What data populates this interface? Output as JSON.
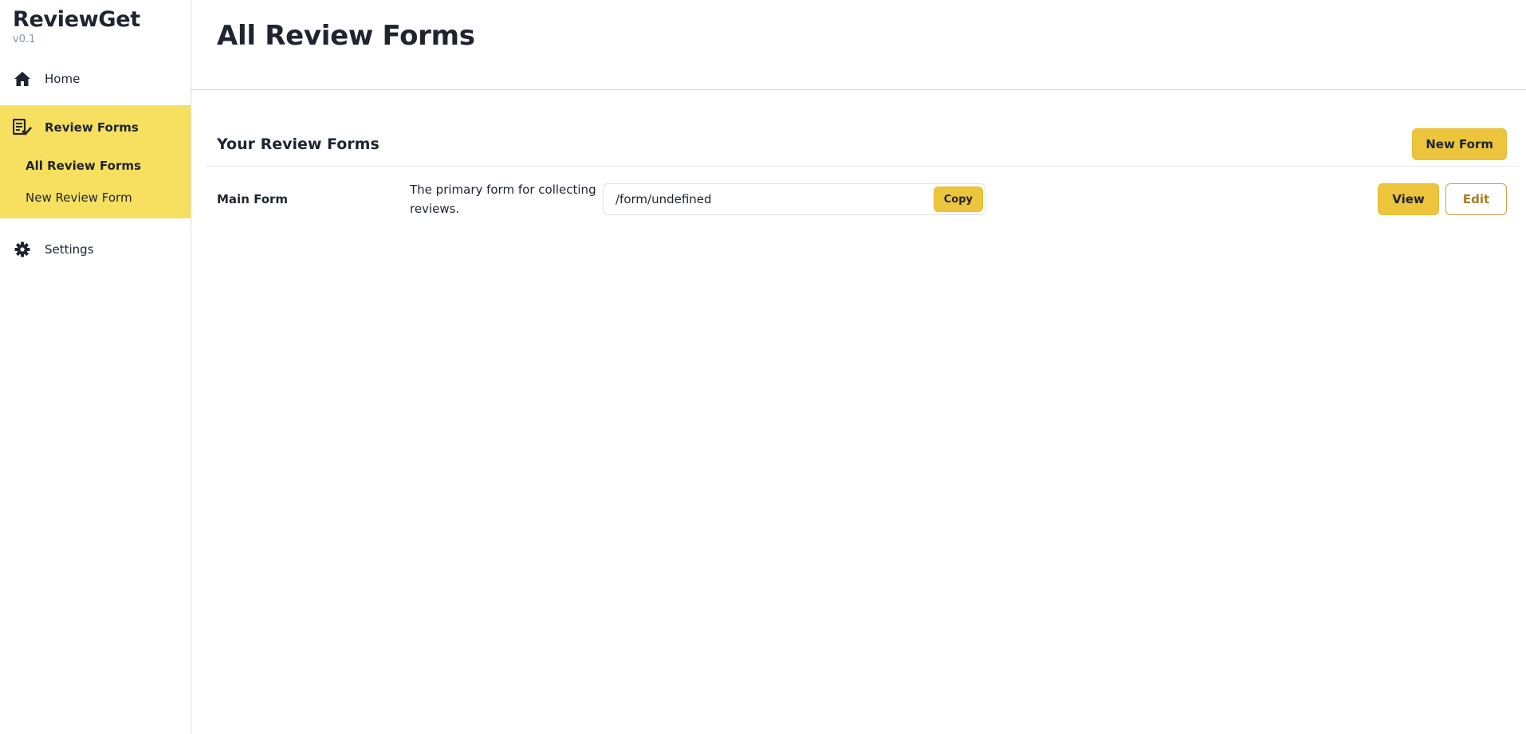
{
  "brand": {
    "name": "ReviewGet",
    "version": "v0.1"
  },
  "sidebar": {
    "home_label": "Home",
    "review_forms_label": "Review Forms",
    "sub_items": [
      {
        "label": "All Review Forms",
        "active": true
      },
      {
        "label": "New Review Form",
        "active": false
      }
    ],
    "settings_label": "Settings",
    "active_bg": "#f7e060"
  },
  "page": {
    "title": "All Review Forms"
  },
  "card": {
    "title": "Your Review Forms",
    "new_button": "New Form"
  },
  "forms": [
    {
      "name": "Main Form",
      "description": "The primary form for collecting reviews.",
      "link": "/form/undefined",
      "copy_label": "Copy",
      "view_label": "View",
      "edit_label": "Edit"
    }
  ],
  "colors": {
    "accent": "#ecc53c",
    "edit_text": "#a87d22"
  },
  "icons": [
    "home-icon",
    "review-forms-icon",
    "gear-icon"
  ]
}
